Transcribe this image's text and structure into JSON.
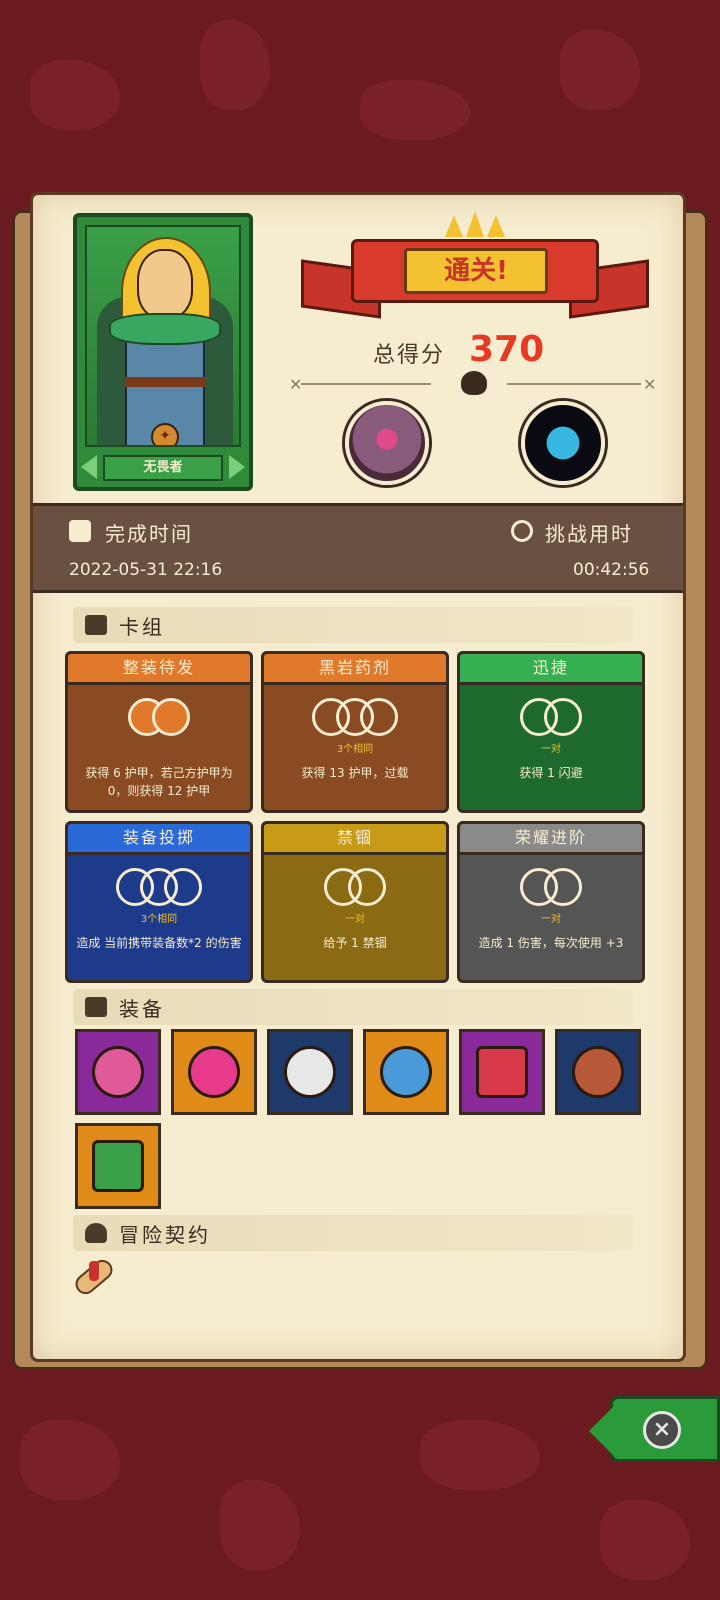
{
  "hero": {
    "name": "无畏者"
  },
  "result": {
    "banner": "通关!",
    "score_label": "总得分",
    "score_value": "370"
  },
  "times": {
    "completion_label": "完成时间",
    "completion_value": "2022-05-31  22:16",
    "duration_label": "挑战用时",
    "duration_value": "00:42:56"
  },
  "sections": {
    "deck": "卡组",
    "equipment": "装备",
    "contract": "冒险契约"
  },
  "cards": [
    {
      "title": "整装待发",
      "sub": "",
      "desc": "获得 6 护甲，若己方护甲为0，则获得 12 护甲",
      "color": "orange"
    },
    {
      "title": "黑岩药剂",
      "sub": "3个相同",
      "desc": "获得 13 护甲，过载",
      "color": "orange"
    },
    {
      "title": "迅捷",
      "sub": "一对",
      "desc": "获得 1 闪避",
      "color": "green"
    },
    {
      "title": "装备投掷",
      "sub": "3个相同",
      "desc": "造成 当前携带装备数*2 的伤害",
      "color": "blue"
    },
    {
      "title": "禁锢",
      "sub": "一对",
      "desc": "给予 1 禁锢",
      "color": "gold"
    },
    {
      "title": "荣耀进阶",
      "sub": "一对",
      "desc": "造成 1 伤害，每次使用 +3",
      "color": "gray"
    }
  ],
  "equipment": [
    {
      "icon": "heart-charm-icon",
      "bg": "#8a2a9a"
    },
    {
      "icon": "bomb-orb-icon",
      "bg": "#e08a18"
    },
    {
      "icon": "skull-mask-icon",
      "bg": "#1e3a6a"
    },
    {
      "icon": "slime-icon",
      "bg": "#e08a18"
    },
    {
      "icon": "flesh-cube-icon",
      "bg": "#8a2a9a"
    },
    {
      "icon": "spiked-shield-icon",
      "bg": "#1e3a6a"
    },
    {
      "icon": "moss-brick-icon",
      "bg": "#e08a18"
    }
  ],
  "icons": {
    "close": "close-icon",
    "contract_scroll": "scroll-icon"
  }
}
